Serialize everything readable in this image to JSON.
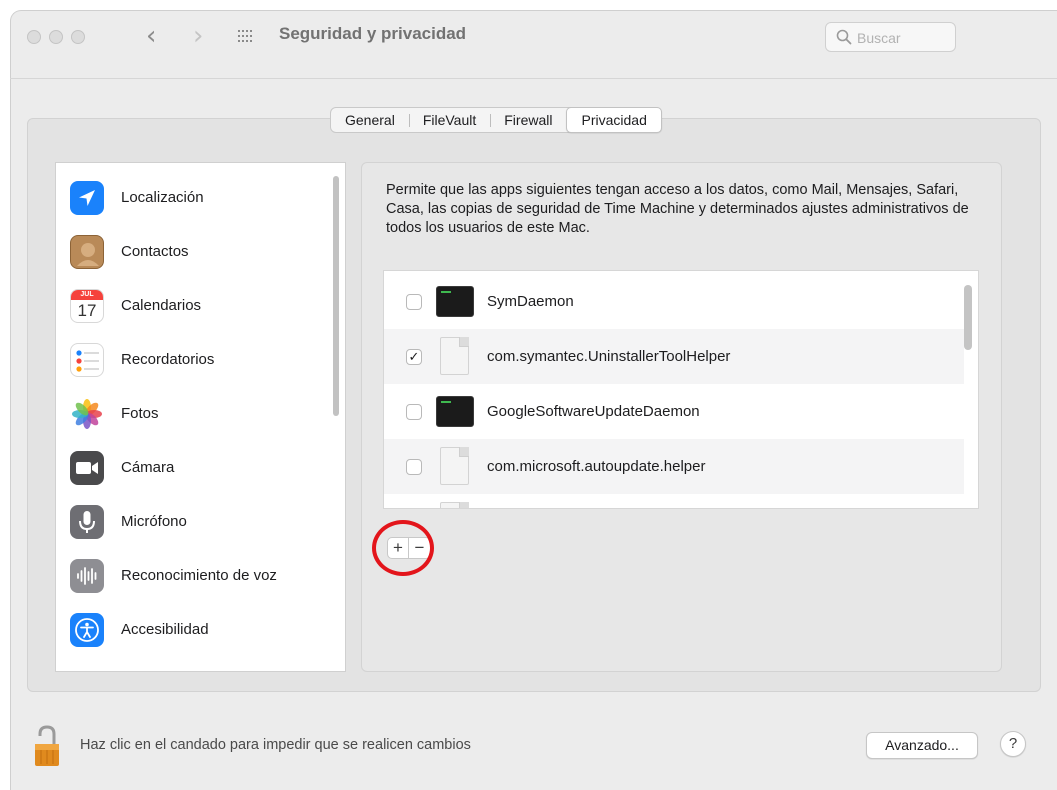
{
  "window": {
    "title": "Seguridad y privacidad"
  },
  "search": {
    "placeholder": "Buscar"
  },
  "tabs": [
    {
      "label": "General",
      "active": false
    },
    {
      "label": "FileVault",
      "active": false
    },
    {
      "label": "Firewall",
      "active": false
    },
    {
      "label": "Privacidad",
      "active": true
    }
  ],
  "sidebar": {
    "items": [
      {
        "label": "Localización",
        "icon": "location-arrow-icon"
      },
      {
        "label": "Contactos",
        "icon": "contacts-icon"
      },
      {
        "label": "Calendarios",
        "icon": "calendar-icon",
        "icon_month": "JUL",
        "icon_day": "17"
      },
      {
        "label": "Recordatorios",
        "icon": "reminders-icon"
      },
      {
        "label": "Fotos",
        "icon": "photos-icon"
      },
      {
        "label": "Cámara",
        "icon": "camera-icon"
      },
      {
        "label": "Micrófono",
        "icon": "microphone-icon"
      },
      {
        "label": "Reconocimiento de voz",
        "icon": "speech-recognition-icon"
      },
      {
        "label": "Accesibilidad",
        "icon": "accessibility-icon"
      }
    ]
  },
  "main": {
    "description": "Permite que las apps siguientes tengan acceso a los datos, como Mail, Mensajes, Safari, Casa, las copias de seguridad de Time Machine y determinados ajustes administrativos de todos los usuarios de este Mac.",
    "apps": [
      {
        "name": "SymDaemon",
        "checked": false,
        "icon": "terminal-icon"
      },
      {
        "name": "com.symantec.UninstallerToolHelper",
        "checked": true,
        "icon": "document-icon"
      },
      {
        "name": "GoogleSoftwareUpdateDaemon",
        "checked": false,
        "icon": "terminal-icon"
      },
      {
        "name": "com.microsoft.autoupdate.helper",
        "checked": false,
        "icon": "document-icon"
      }
    ],
    "add_label": "+",
    "remove_label": "−"
  },
  "footer": {
    "lock_text": "Haz clic en el candado para impedir que se realicen cambios",
    "advanced_label": "Avanzado...",
    "help_label": "?"
  },
  "colors": {
    "annotation_circle": "#e3151b",
    "checkmark": "#1d1d1f"
  }
}
